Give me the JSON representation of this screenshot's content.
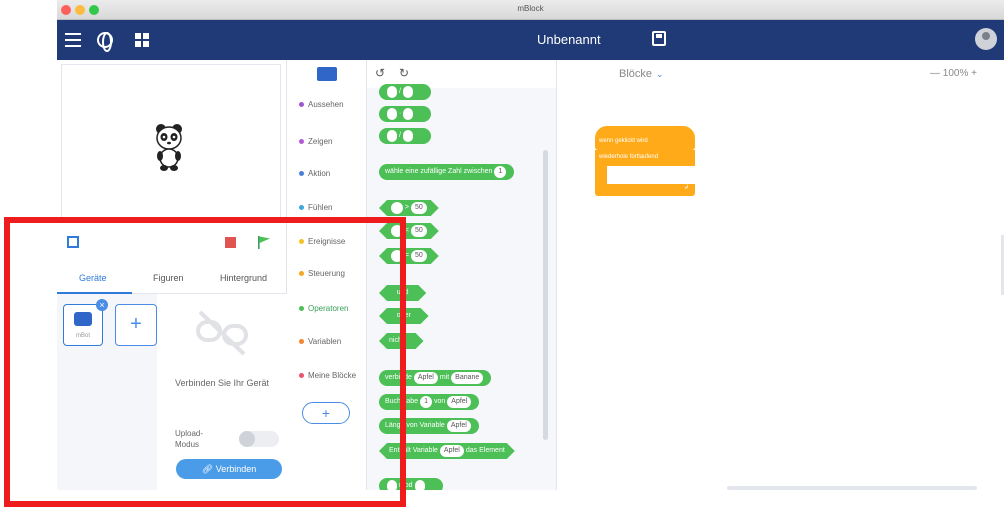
{
  "window": {
    "title": "mBlock",
    "traffic_lights": [
      "#fc605b",
      "#fdbc40",
      "#34c84a"
    ]
  },
  "header": {
    "project_name": "Unbenannt",
    "background": "#1f3a77",
    "icons": [
      "menu-icon",
      "globe-icon",
      "grid-icon",
      "save-icon",
      "avatar"
    ]
  },
  "left_panel": {
    "tabs": [
      {
        "label": "Geräte",
        "active": true
      },
      {
        "label": "Figuren",
        "active": false
      },
      {
        "label": "Hintergrund",
        "active": false
      }
    ],
    "device": {
      "label": "mBot",
      "badge": "×"
    },
    "add_symbol": "+",
    "connect_text": "Verbinden Sie Ihr Gerät",
    "upload_mode_label": "Upload-Modus",
    "upload_mode_on": false,
    "connect_button": "Verbinden",
    "highlight_color": "#ee1c1c"
  },
  "categories": {
    "items": [
      {
        "label": "Aussehen",
        "color": "#9b59d0",
        "active": false
      },
      {
        "label": "Zeigen",
        "color": "#b05bd6",
        "active": false
      },
      {
        "label": "Aktion",
        "color": "#4a7fd9",
        "active": false
      },
      {
        "label": "Fühlen",
        "color": "#3fa6d8",
        "active": false
      },
      {
        "label": "Ereignisse",
        "color": "#f5c222",
        "active": false
      },
      {
        "label": "Steuerung",
        "color": "#f5a623",
        "active": false
      },
      {
        "label": "Operatoren",
        "color": "#4cbf56",
        "active": true
      },
      {
        "label": "Variablen",
        "color": "#f5862e",
        "active": false
      },
      {
        "label": "Meine Blöcke",
        "color": "#e9556f",
        "active": false
      }
    ],
    "add_symbol": "+"
  },
  "palette": {
    "undo": "↺",
    "redo": "↻",
    "ops": [
      "/",
      "·",
      "/"
    ],
    "random": {
      "text": "wähle eine zufällige Zahl zwischen",
      "value": "1"
    },
    "compare": [
      {
        "op": ">",
        "value": "50"
      },
      {
        "op": "<",
        "value": "50"
      },
      {
        "op": "=",
        "value": "50"
      }
    ],
    "logic": [
      "und",
      "oder",
      "nicht"
    ],
    "join": {
      "pre": "verbinde",
      "a": "Apfel",
      "mid": "mit",
      "b": "Banane"
    },
    "letter": {
      "pre": "Buchstabe",
      "n": "1",
      "mid": "von",
      "s": "Apfel"
    },
    "length": {
      "pre": "Länge von Variable",
      "s": "Apfel"
    },
    "contains": {
      "pre": "Enthält Variable",
      "s": "Apfel",
      "post": "das Element"
    },
    "last": {
      "pre": "",
      "op": "mod"
    }
  },
  "workspace": {
    "title": "Blöcke",
    "chevron": "⌄",
    "zoom_minus": "—",
    "zoom_level": "100%",
    "zoom_plus": "+",
    "script": {
      "hat": "wenn  geklickt wird",
      "loop": "wiederhole fortlaufend",
      "loop_end": "↲"
    }
  }
}
